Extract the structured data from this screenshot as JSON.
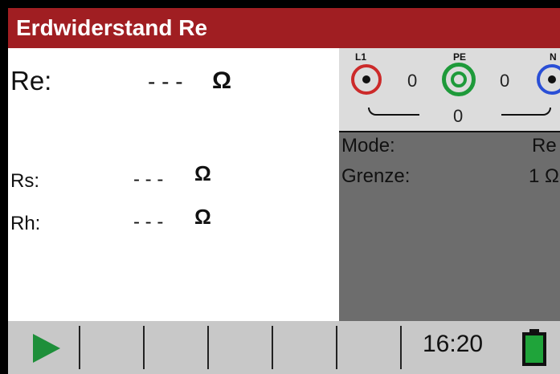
{
  "title": "Erdwiderstand Re",
  "measurements": {
    "re": {
      "label": "Re:",
      "value": "- - -",
      "unit": "Ω"
    },
    "rs": {
      "label": "Rs:",
      "value": "- - -",
      "unit": "Ω"
    },
    "rh": {
      "label": "Rh:",
      "value": "- - -",
      "unit": "Ω"
    }
  },
  "probes": {
    "l1": {
      "label": "L1",
      "color": "#cc2a2a"
    },
    "pe": {
      "label": "PE",
      "color": "#1e9a3a"
    },
    "n": {
      "label": "N",
      "color": "#2a4fd6"
    },
    "l1_pe_value": "0",
    "pe_n_value": "0",
    "l1_n_value": "0"
  },
  "settings": {
    "mode_label": "Mode:",
    "mode_value": "Re",
    "limit_label": "Grenze:",
    "limit_value": "1 Ω"
  },
  "status": {
    "time": "16:20",
    "battery_level": 1.0
  },
  "colors": {
    "title_bar": "#a01e22",
    "play": "#1e8f3a",
    "battery": "#1fa43a"
  },
  "icons": [
    "play-icon",
    "battery-icon"
  ]
}
